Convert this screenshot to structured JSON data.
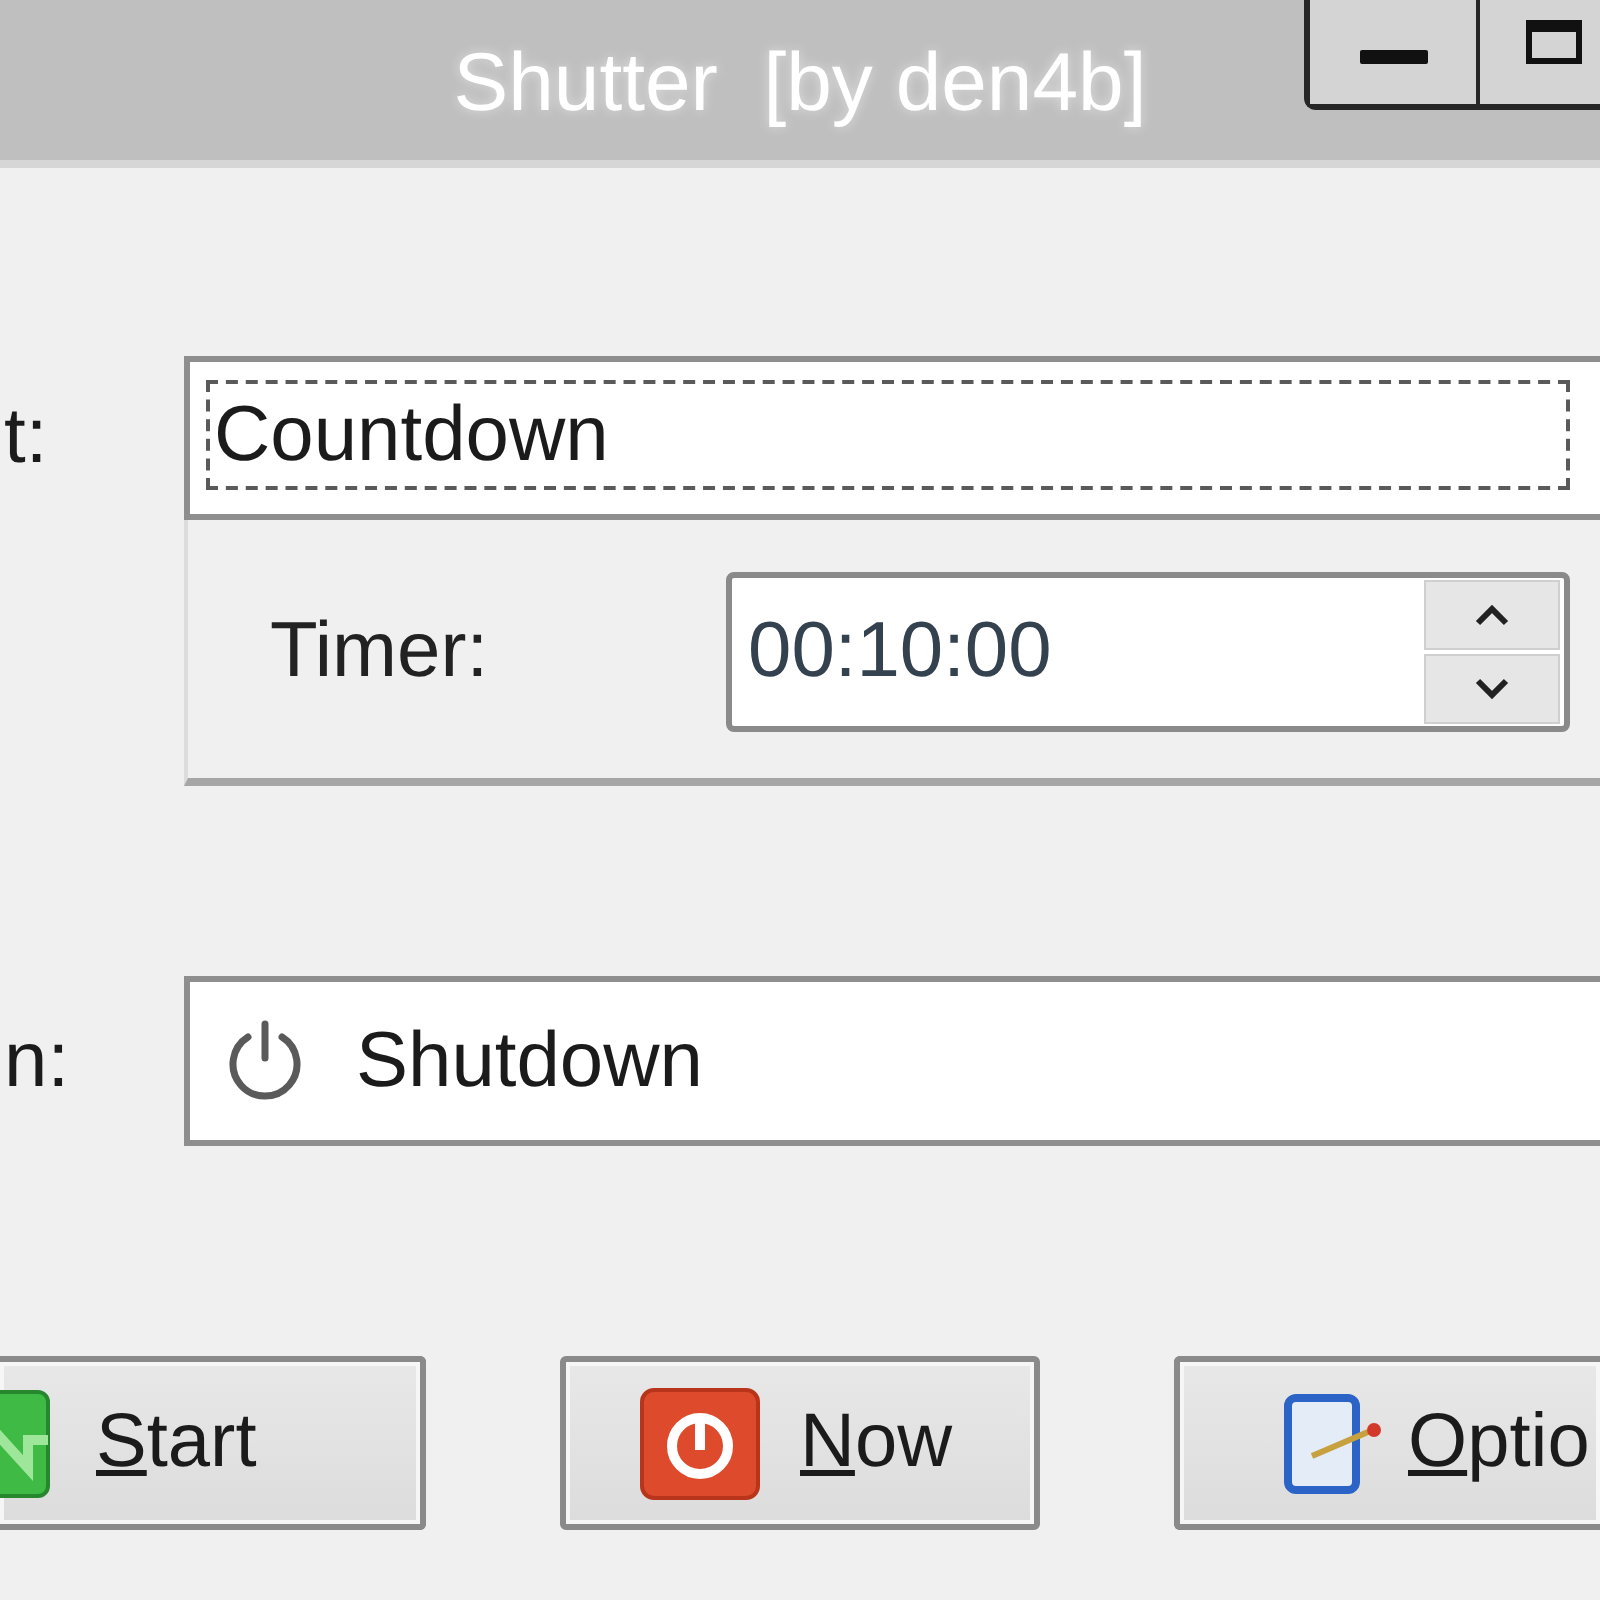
{
  "window": {
    "title": "Shutter  [by den4b]",
    "controls": [
      {
        "kind": "minimize"
      },
      {
        "kind": "maximize"
      }
    ]
  },
  "event": {
    "label": "t:",
    "value": "Countdown",
    "focused": true
  },
  "timer": {
    "label": "Timer:",
    "value": "00:10:00"
  },
  "action": {
    "label": "n:",
    "value": "Shutdown"
  },
  "buttons": [
    {
      "kind": "start",
      "label": "Start",
      "mnemonic_underlined": true
    },
    {
      "kind": "now",
      "label": "Now",
      "mnemonic_underlined": true
    },
    {
      "kind": "options",
      "label": "Optio",
      "mnemonic_underlined": true
    }
  ]
}
